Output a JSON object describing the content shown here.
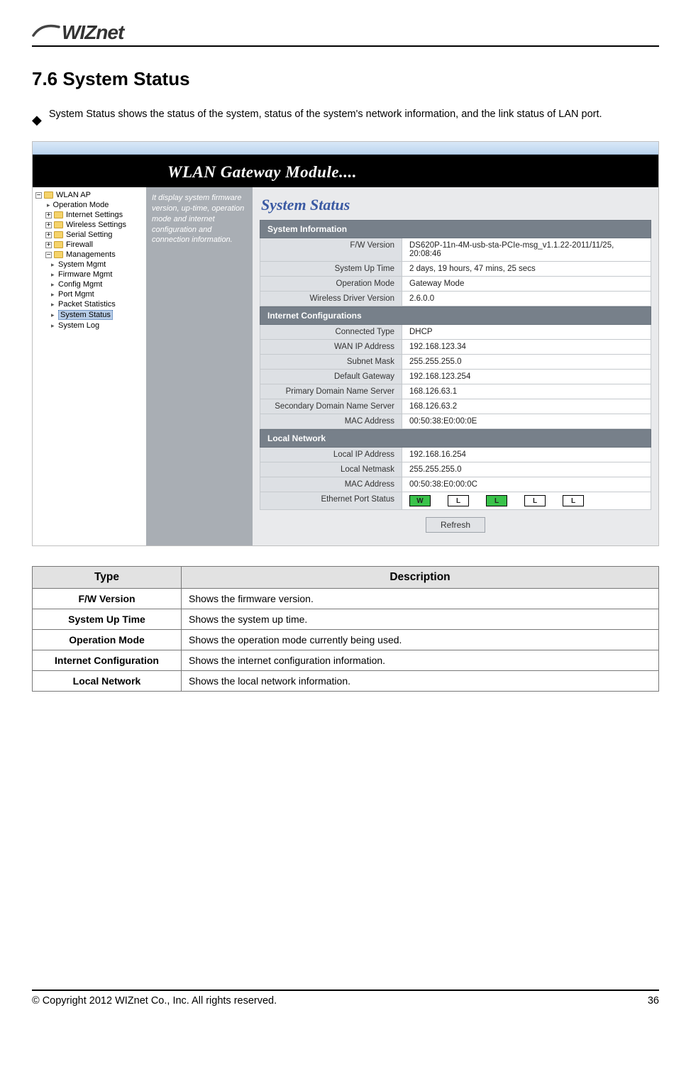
{
  "logo_text": "WIZnet",
  "section_title": "7.6 System Status",
  "intro_text": "System Status shows the status of the system, status of the system's network information, and the link status of LAN port.",
  "banner": "WLAN Gateway Module....",
  "tree": {
    "root": "WLAN AP",
    "items": [
      "Operation Mode",
      "Internet Settings",
      "Wireless Settings",
      "Serial Setting",
      "Firewall",
      "Managements"
    ],
    "children": [
      "System Mgmt",
      "Firmware Mgmt",
      "Config Mgmt",
      "Port Mgmt",
      "Packet Statistics",
      "System Status",
      "System Log"
    ]
  },
  "side_desc": "It display system firmware version, up-time, operation mode and internet configuration and connection information.",
  "page_heading": "System Status",
  "sysinfo_hdr": "System Information",
  "sysinfo": [
    {
      "k": "F/W Version",
      "v": "DS620P-11n-4M-usb-sta-PCIe-msg_v1.1.22-2011/11/25, 20:08:46"
    },
    {
      "k": "System Up Time",
      "v": "2 days, 19 hours, 47 mins, 25 secs"
    },
    {
      "k": "Operation Mode",
      "v": "Gateway Mode"
    },
    {
      "k": "Wireless Driver Version",
      "v": "2.6.0.0"
    }
  ],
  "netconf_hdr": "Internet Configurations",
  "netconf": [
    {
      "k": "Connected Type",
      "v": "DHCP"
    },
    {
      "k": "WAN IP Address",
      "v": "192.168.123.34"
    },
    {
      "k": "Subnet Mask",
      "v": "255.255.255.0"
    },
    {
      "k": "Default Gateway",
      "v": "192.168.123.254"
    },
    {
      "k": "Primary Domain Name Server",
      "v": "168.126.63.1"
    },
    {
      "k": "Secondary Domain Name Server",
      "v": "168.126.63.2"
    },
    {
      "k": "MAC Address",
      "v": "00:50:38:E0:00:0E"
    }
  ],
  "local_hdr": "Local Network",
  "local": [
    {
      "k": "Local IP Address",
      "v": "192.168.16.254"
    },
    {
      "k": "Local Netmask",
      "v": "255.255.255.0"
    },
    {
      "k": "MAC Address",
      "v": "00:50:38:E0:00:0C"
    }
  ],
  "port_label": "Ethernet Port Status",
  "ports": [
    "W",
    "L",
    "L",
    "L",
    "L"
  ],
  "refresh": "Refresh",
  "table": {
    "head_type": "Type",
    "head_desc": "Description",
    "rows": [
      {
        "t": "F/W Version",
        "d": "Shows the firmware version."
      },
      {
        "t": "System Up Time",
        "d": "Shows the system up time."
      },
      {
        "t": "Operation Mode",
        "d": "Shows the operation mode currently being used."
      },
      {
        "t": "Internet Configuration",
        "d": "Shows the internet configuration information."
      },
      {
        "t": "Local Network",
        "d": "Shows the local network information."
      }
    ]
  },
  "footer_copy": "© Copyright 2012 WIZnet Co., Inc. All rights reserved.",
  "footer_page": "36"
}
